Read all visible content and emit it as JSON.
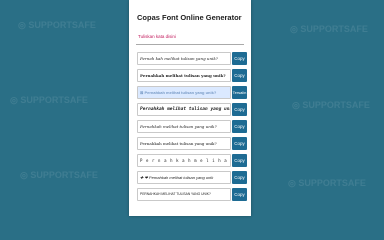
{
  "page": {
    "title": "Copas Font Online Generator",
    "input_value": "Tuliskan kata disini",
    "input_underlined_text": "Tuliskan kata disini"
  },
  "rows": [
    {
      "text": "Pernah kah melihat tulisan yang unik?",
      "button": "Copy"
    },
    {
      "text": "Pernahkah melihat tulisan yang unik?",
      "button": "Copy"
    },
    {
      "text": "⊠ Pernahkah melihat tulisan yang unik?",
      "button": "Tersalin"
    },
    {
      "text": "Pernahkah melihat tulisan yang unik",
      "button": "Copy"
    },
    {
      "text": "Pernahkah melihat tulisan yang unik?",
      "button": "Copy"
    },
    {
      "text": "Pernahkah melihat tulisan yang unik?",
      "button": "Copy"
    },
    {
      "text": "P e r n a h k a h m e l i h a t  t u l i s a",
      "button": "Copy"
    },
    {
      "text": "✚ ❤ Pernahkah melihat tulisan yang unik",
      "button": "Copy"
    },
    {
      "text": "PERNAHKAH MELIHAT TULISAN YANG UNIK?",
      "button": "Copy"
    }
  ],
  "colors": {
    "background": "#2a6f86",
    "button": "#1e6b93",
    "link": "#c2185b"
  }
}
